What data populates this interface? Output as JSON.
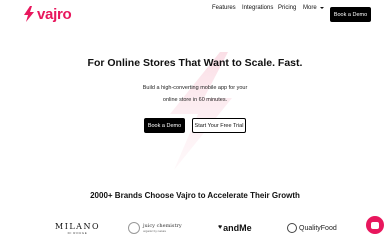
{
  "brand": {
    "name": "vajro",
    "color": "#e8175d"
  },
  "nav": {
    "items": [
      "Features",
      "Integrations",
      "Pricing"
    ],
    "more_label": "More",
    "demo_label": "Book a Demo"
  },
  "hero": {
    "title": "For Online Stores That Want to Scale. Fast.",
    "subtitle_line1": "Build a high-converting mobile app for your",
    "subtitle_line2": "online store in 60 minutes.",
    "primary_cta": "Book a Demo",
    "secondary_cta": "Start Your Free Trial"
  },
  "brands": {
    "title": "2000+ Brands Choose Vajro to Accelerate Their Growth",
    "milano": {
      "name": "MILANO",
      "tagline": "DI ROUGE"
    },
    "juicy": {
      "name": "juicy chemistry",
      "tagline": "organic by nature"
    },
    "andme": {
      "name": "andMe"
    },
    "qualityfood": {
      "name": "QualityFood"
    }
  },
  "icons": {
    "logo": "lightning-bolt-icon",
    "more": "chevron-down-icon",
    "chat": "chat-icon"
  }
}
